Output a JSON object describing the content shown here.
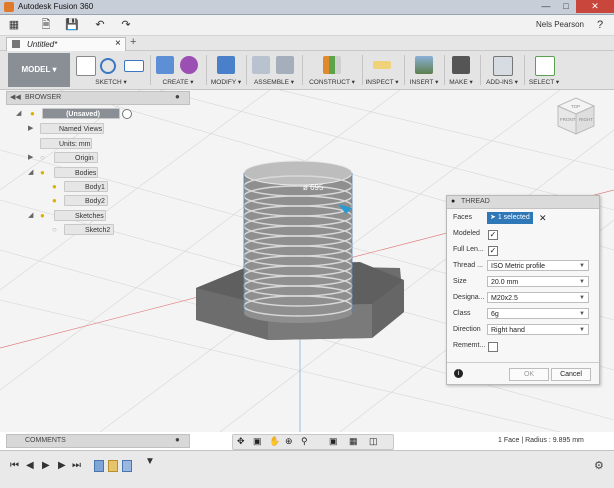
{
  "app": {
    "title": "Autodesk Fusion 360",
    "user": "Nels Pearson"
  },
  "tabs": [
    {
      "label": "Untitled*"
    }
  ],
  "workspace": {
    "label": "MODEL ▾"
  },
  "ribbon": {
    "groups": [
      {
        "label": "SKETCH ▾"
      },
      {
        "label": "CREATE ▾"
      },
      {
        "label": "MODIFY ▾"
      },
      {
        "label": "ASSEMBLE ▾"
      },
      {
        "label": "CONSTRUCT ▾"
      },
      {
        "label": "INSPECT ▾"
      },
      {
        "label": "INSERT ▾"
      },
      {
        "label": "MAKE ▾"
      },
      {
        "label": "ADD-INS ▾"
      },
      {
        "label": "SELECT ▾"
      }
    ]
  },
  "browser": {
    "title": "BROWSER",
    "nodes": [
      {
        "label": "(Unsaved)"
      },
      {
        "label": "Named Views"
      },
      {
        "label": "Units: mm"
      },
      {
        "label": "Origin"
      },
      {
        "label": "Bodies"
      },
      {
        "label": "Body1"
      },
      {
        "label": "Body2"
      },
      {
        "label": "Sketches"
      },
      {
        "label": "Sketch2"
      }
    ]
  },
  "viewcube": {
    "top": "TOP",
    "front": "FRONT",
    "right": "RIGHT"
  },
  "viewport": {
    "dimension_label": "ø 695"
  },
  "thread_panel": {
    "title": "THREAD",
    "faces_label": "Faces",
    "faces_value": "1 selected",
    "modeled_label": "Modeled",
    "modeled_checked": true,
    "full_length_label": "Full Len...",
    "full_length_checked": true,
    "thread_type_label": "Thread ...",
    "thread_type_value": "ISO Metric profile",
    "size_label": "Size",
    "size_value": "20.0 mm",
    "designation_label": "Designa...",
    "designation_value": "M20x2.5",
    "class_label": "Class",
    "class_value": "6g",
    "direction_label": "Direction",
    "direction_value": "Right hand",
    "remember_label": "Rememt...",
    "remember_checked": false,
    "ok_label": "OK",
    "cancel_label": "Cancel"
  },
  "comments": {
    "title": "COMMENTS"
  },
  "status": {
    "text": "1 Face | Radius : 9.895 mm"
  },
  "colors": {
    "accent": "#2f78b8",
    "title_bar": "#c8ced8",
    "close_button": "#c9463d"
  }
}
